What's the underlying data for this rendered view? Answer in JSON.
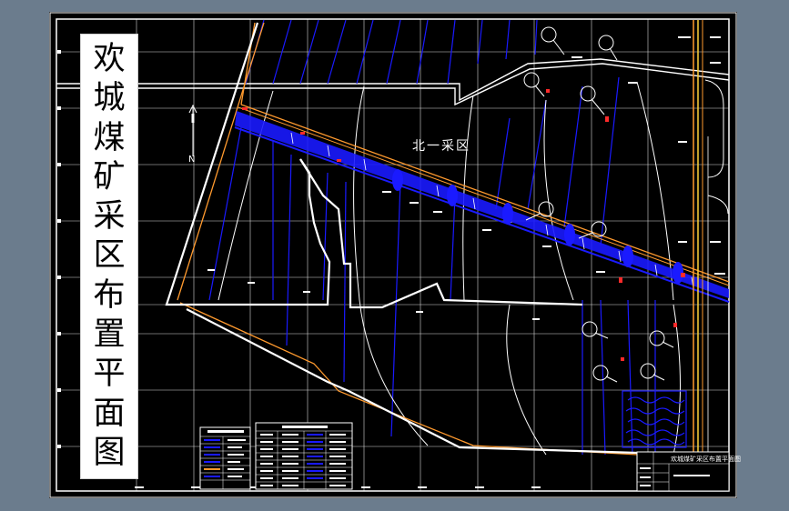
{
  "drawing": {
    "title_chars": [
      "欢",
      "城",
      "煤",
      "矿",
      "采",
      "区",
      "布",
      "置",
      "平",
      "面",
      "图"
    ],
    "region_label": "北一采区",
    "north_label": "N",
    "title_block_text": "欢城煤矿采区布置平面图"
  },
  "colors": {
    "background": "#6b7c8d",
    "drawing_area": "#000000",
    "frame": "#ffffff",
    "grid": "#ffffff",
    "boundary": "#ff9a2e",
    "roadway": "#1a1aff",
    "title_block_bg": "#ffffff"
  }
}
